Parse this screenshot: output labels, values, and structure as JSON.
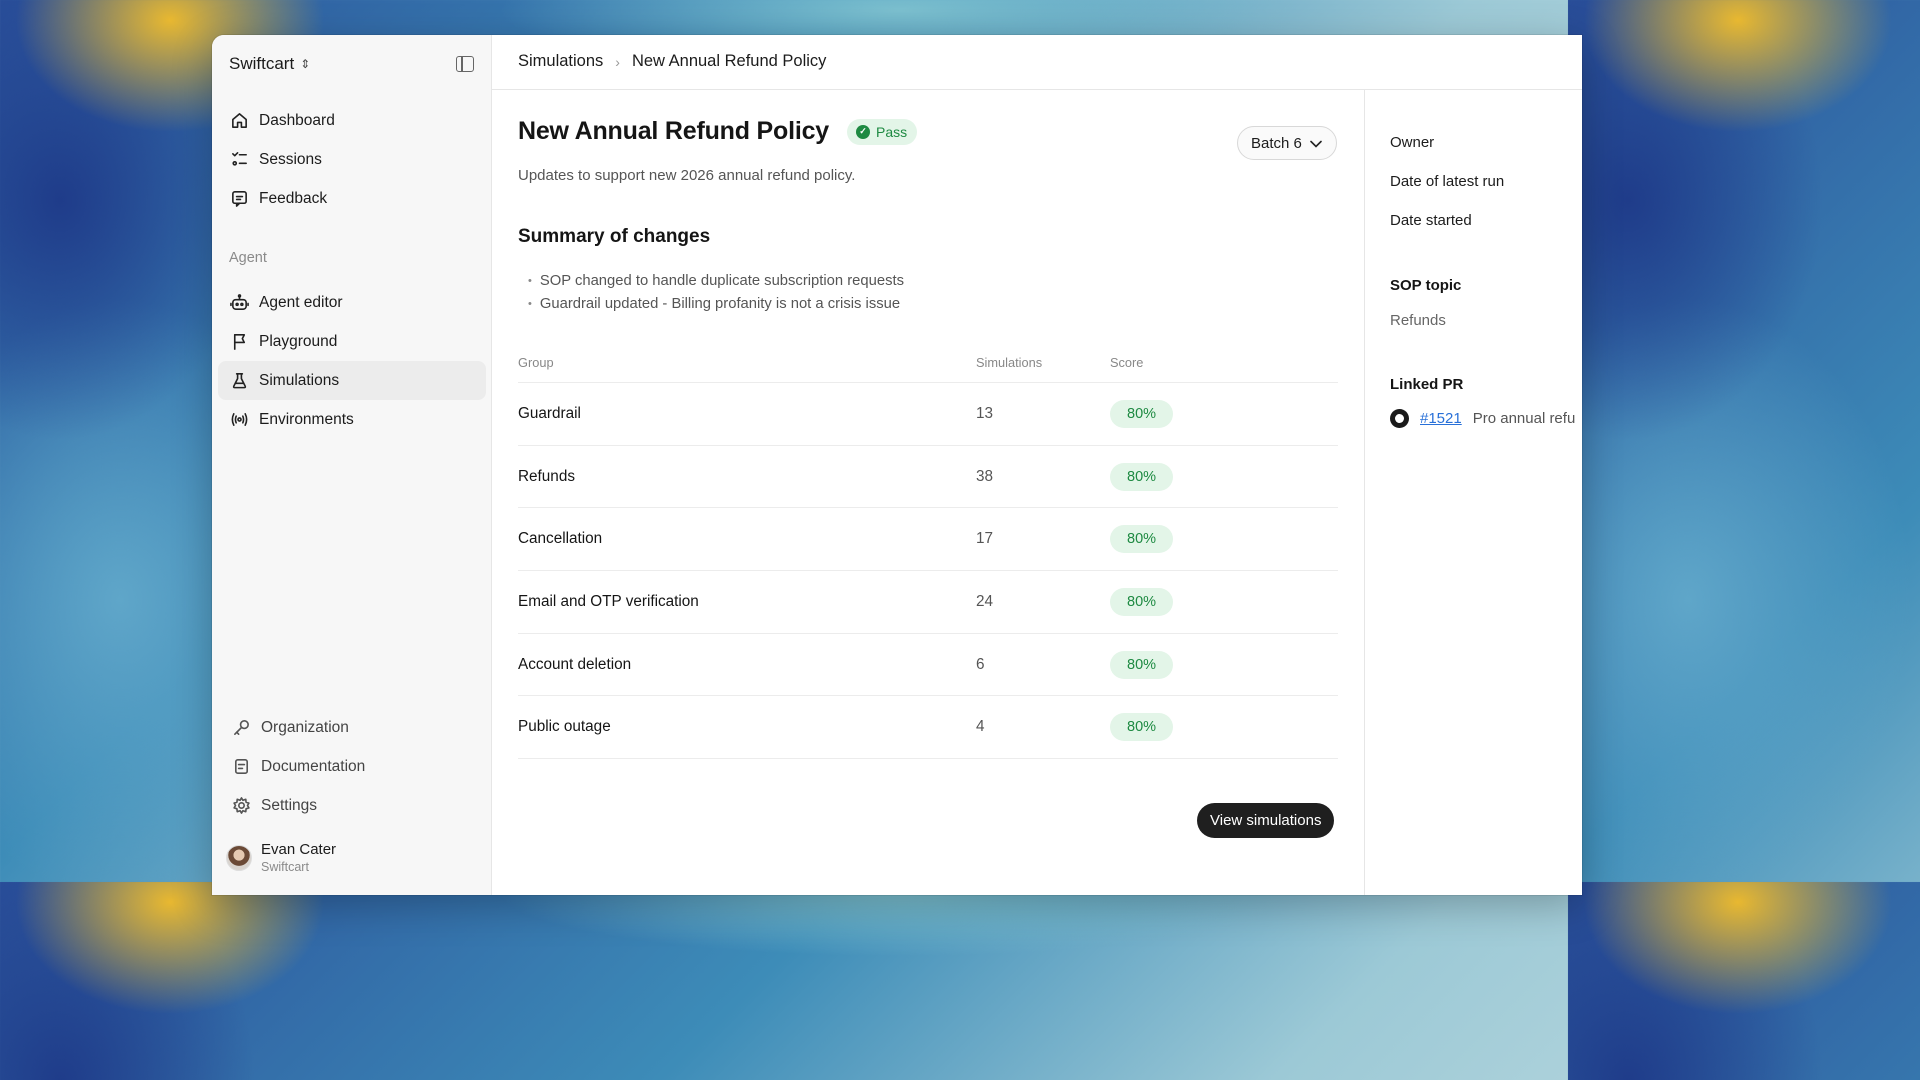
{
  "sidebar": {
    "workspace": "Swiftcart",
    "nav": [
      {
        "label": "Dashboard",
        "icon": "home-icon"
      },
      {
        "label": "Sessions",
        "icon": "sessions-list-icon"
      },
      {
        "label": "Feedback",
        "icon": "feedback-icon"
      }
    ],
    "agent_section_label": "Agent",
    "agent_nav": [
      {
        "label": "Agent editor",
        "icon": "robot-icon"
      },
      {
        "label": "Playground",
        "icon": "flag-icon"
      },
      {
        "label": "Simulations",
        "icon": "flask-icon",
        "active": true
      },
      {
        "label": "Environments",
        "icon": "broadcast-icon"
      }
    ],
    "footer_nav": [
      {
        "label": "Organization",
        "icon": "key-icon"
      },
      {
        "label": "Documentation",
        "icon": "document-icon"
      },
      {
        "label": "Settings",
        "icon": "gear-icon"
      }
    ],
    "user": {
      "name": "Evan Cater",
      "org": "Swiftcart"
    }
  },
  "breadcrumb": {
    "root": "Simulations",
    "current": "New Annual Refund Policy"
  },
  "page": {
    "title": "New Annual Refund Policy",
    "status": "Pass",
    "batch": "Batch 6",
    "subtitle": "Updates to support new 2026 annual refund policy.",
    "summary_heading": "Summary of changes",
    "summary_items": [
      "SOP changed to handle duplicate subscription requests",
      "Guardrail updated - Billing profanity is not a crisis issue"
    ]
  },
  "table": {
    "headers": {
      "group": "Group",
      "simulations": "Simulations",
      "score": "Score"
    },
    "rows": [
      {
        "group": "Guardrail",
        "simulations": "13",
        "score": "80%"
      },
      {
        "group": "Refunds",
        "simulations": "38",
        "score": "80%"
      },
      {
        "group": "Cancellation",
        "simulations": "17",
        "score": "80%"
      },
      {
        "group": "Email and OTP verification",
        "simulations": "24",
        "score": "80%"
      },
      {
        "group": "Account deletion",
        "simulations": "6",
        "score": "80%"
      },
      {
        "group": "Public outage",
        "simulations": "4",
        "score": "80%"
      }
    ]
  },
  "actions": {
    "view_simulations": "View simulations"
  },
  "details": {
    "owner_label": "Owner",
    "latest_run_label": "Date of latest run",
    "started_label": "Date started",
    "sop_topic_label": "SOP topic",
    "sop_topic_value": "Refunds",
    "linked_pr_label": "Linked PR",
    "pr_number": "#1521",
    "pr_title": "Pro annual refu"
  },
  "colors": {
    "pass_green": "#1e8a42",
    "pass_bg": "#e3f5e8",
    "link": "#2870d8",
    "button_dark": "#1f1f1f"
  }
}
